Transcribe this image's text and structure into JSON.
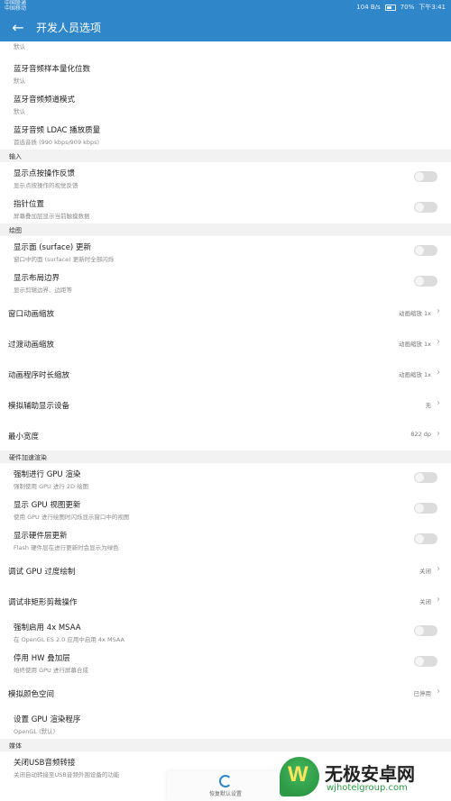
{
  "statusbar": {
    "carrier1": "中国联通",
    "carrier2": "中国移动",
    "speed": "104 B/s",
    "battery": "70%",
    "time": "下午3:41"
  },
  "appbar": {
    "title": "开发人员选项"
  },
  "top_partial": {
    "sub": "默认"
  },
  "rows": [
    {
      "title": "蓝牙音频样本量化位数",
      "sub": "默认"
    },
    {
      "title": "蓝牙音频频道模式",
      "sub": "默认"
    },
    {
      "title": "蓝牙音频 LDAC 播放质量",
      "sub": "首选音质 (990 kbps/909 kbps)"
    }
  ],
  "sections": {
    "input": "输入",
    "drawing": "绘图",
    "hw": "硬件加速渲染",
    "media": "媒体"
  },
  "input_rows": [
    {
      "title": "显示点按操作反馈",
      "sub": "显示点按操作的视觉反馈"
    },
    {
      "title": "指针位置",
      "sub": "屏幕叠加层显示当前触摸数据"
    }
  ],
  "drawing_rows": [
    {
      "title": "显示面 (surface) 更新",
      "sub": "窗口中的面 (surface) 更新时全部闪烁"
    },
    {
      "title": "显示布局边界",
      "sub": "显示剪辑边界、边距等"
    }
  ],
  "drawing_single": [
    {
      "title": "窗口动画缩放",
      "value": "动画缩放 1x"
    },
    {
      "title": "过渡动画缩放",
      "value": "动画缩放 1x"
    },
    {
      "title": "动画程序时长缩放",
      "value": "动画缩放 1x"
    },
    {
      "title": "模拟辅助显示设备",
      "value": "无"
    },
    {
      "title": "最小宽度",
      "value": "822 dp"
    }
  ],
  "hw_rows": [
    {
      "title": "强制进行 GPU 渲染",
      "sub": "强制使用 GPU 进行 2D 绘图"
    },
    {
      "title": "显示 GPU 视图更新",
      "sub": "使用 GPU 进行绘图时闪烁显示窗口中的视图"
    },
    {
      "title": "显示硬件层更新",
      "sub": "Flash 硬件层在进行更新时会显示为绿色"
    }
  ],
  "hw_single": [
    {
      "title": "调试 GPU 过度绘制",
      "value": "关闭"
    },
    {
      "title": "调试非矩形剪裁操作",
      "value": "关闭"
    }
  ],
  "hw_rows2": [
    {
      "title": "强制启用 4x MSAA",
      "sub": "在 OpenGL ES 2.0 应用中启用 4x MSAA"
    },
    {
      "title": "停用 HW 叠加层",
      "sub": "始终使用 GPU 进行屏幕合成"
    }
  ],
  "hw_single2": [
    {
      "title": "模拟颜色空间",
      "value": "已停用"
    }
  ],
  "renderer": {
    "title": "设置 GPU 渲染程序",
    "sub": "OpenGL (默认)"
  },
  "media_row": {
    "title": "关闭USB音频转接",
    "sub": "关闭自动转接至USB音频外围设备的功能"
  },
  "bottom": {
    "label": "恢复默认设置"
  },
  "watermark": {
    "title": "无极安卓网",
    "url": "wjhotelgroup.com"
  }
}
